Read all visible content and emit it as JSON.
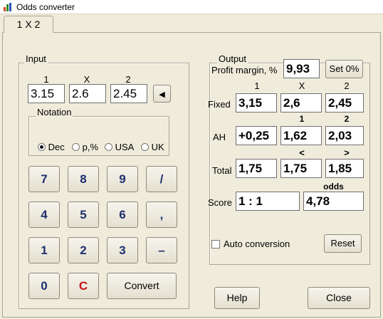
{
  "window": {
    "title": "Odds converter",
    "icon": "bar-chart-icon"
  },
  "tab": {
    "label": "1 X 2"
  },
  "input": {
    "group_label": "Input",
    "col_headers": [
      "1",
      "X",
      "2"
    ],
    "values": [
      "3.15",
      "2.6",
      "2.45"
    ],
    "notation": {
      "label": "Notation",
      "options": [
        "Dec",
        "p,%",
        "USA",
        "UK"
      ],
      "selected": "Dec"
    },
    "keypad": {
      "row1": [
        "7",
        "8",
        "9",
        "/"
      ],
      "row2": [
        "4",
        "5",
        "6",
        ","
      ],
      "row3": [
        "1",
        "2",
        "3",
        "–"
      ],
      "zero": "0",
      "clear": "C",
      "convert": "Convert"
    }
  },
  "output": {
    "group_label": "Output",
    "margin_label": "Profit margin, %",
    "margin_value": "9,93",
    "set0_label": "Set 0%",
    "col_headers": [
      "1",
      "X",
      "2"
    ],
    "fixed": {
      "label": "Fixed",
      "values": [
        "3,15",
        "2,6",
        "2,45"
      ]
    },
    "ah": {
      "label": "AH",
      "headers": [
        "1",
        "2"
      ],
      "values": [
        "+0,25",
        "1,62",
        "2,03"
      ]
    },
    "total": {
      "label": "Total",
      "headers": [
        "<",
        ">"
      ],
      "values": [
        "1,75",
        "1,75",
        "1,85"
      ]
    },
    "score": {
      "label": "Score",
      "value": "1 : 1",
      "odds_header": "odds",
      "odds_value": "4,78"
    },
    "auto_conversion_label": "Auto conversion",
    "auto_conversion_checked": false,
    "reset_label": "Reset"
  },
  "buttons": {
    "help": "Help",
    "close": "Close"
  },
  "colors": {
    "keypad_text": "#1f2f6e",
    "clear_key": "#c41414",
    "background": "#f0ecdc"
  }
}
